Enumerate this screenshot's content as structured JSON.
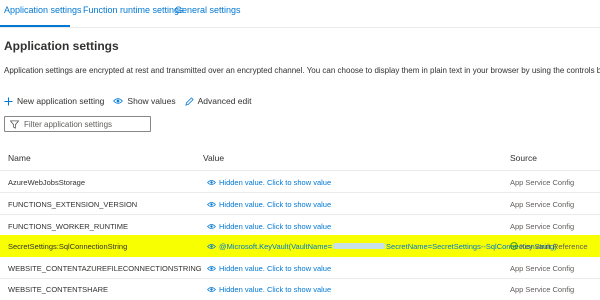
{
  "tabs": [
    {
      "label": "Application settings",
      "active": true
    },
    {
      "label": "Function runtime settings",
      "active": false
    },
    {
      "label": "General settings",
      "active": false
    }
  ],
  "section": {
    "title": "Application settings",
    "description": "Application settings are encrypted at rest and transmitted over an encrypted channel. You can choose to display them in plain text in your browser by using the controls below. Application Settings a"
  },
  "toolbar": {
    "new_label": "New application setting",
    "show_label": "Show values",
    "edit_label": "Advanced edit"
  },
  "filter": {
    "placeholder": "Filter application settings"
  },
  "grid": {
    "columns": {
      "name": "Name",
      "value": "Value",
      "source": "Source"
    },
    "rows": [
      {
        "name": "AzureWebJobsStorage",
        "value": "Hidden value. Click to show value",
        "source": "App Service Config"
      },
      {
        "name": "FUNCTIONS_EXTENSION_VERSION",
        "value": "Hidden value. Click to show value",
        "source": "App Service Config"
      },
      {
        "name": "FUNCTIONS_WORKER_RUNTIME",
        "value": "Hidden value. Click to show value",
        "source": "App Service Config"
      },
      {
        "name": "SecretSettings:SqlConnectionString",
        "value_prefix": "@Microsoft.KeyVault(VaultName=",
        "value_suffix": "SecretName=SecretSettings--SqlConnectionString)",
        "source": "Key vault Reference",
        "highlighted": true
      },
      {
        "name": "WEBSITE_CONTENTAZUREFILECONNECTIONSTRING",
        "value": "Hidden value. Click to show value",
        "source": "App Service Config"
      },
      {
        "name": "WEBSITE_CONTENTSHARE",
        "value": "Hidden value. Click to show value",
        "source": "App Service Config"
      }
    ]
  },
  "colors": {
    "accent": "#0078d4",
    "highlight": "#f7ff00",
    "success": "#107c10"
  },
  "icons": [
    "plus-icon",
    "eye-icon",
    "pencil-icon",
    "filter-icon",
    "eye-icon",
    "key-vault-check-icon"
  ]
}
